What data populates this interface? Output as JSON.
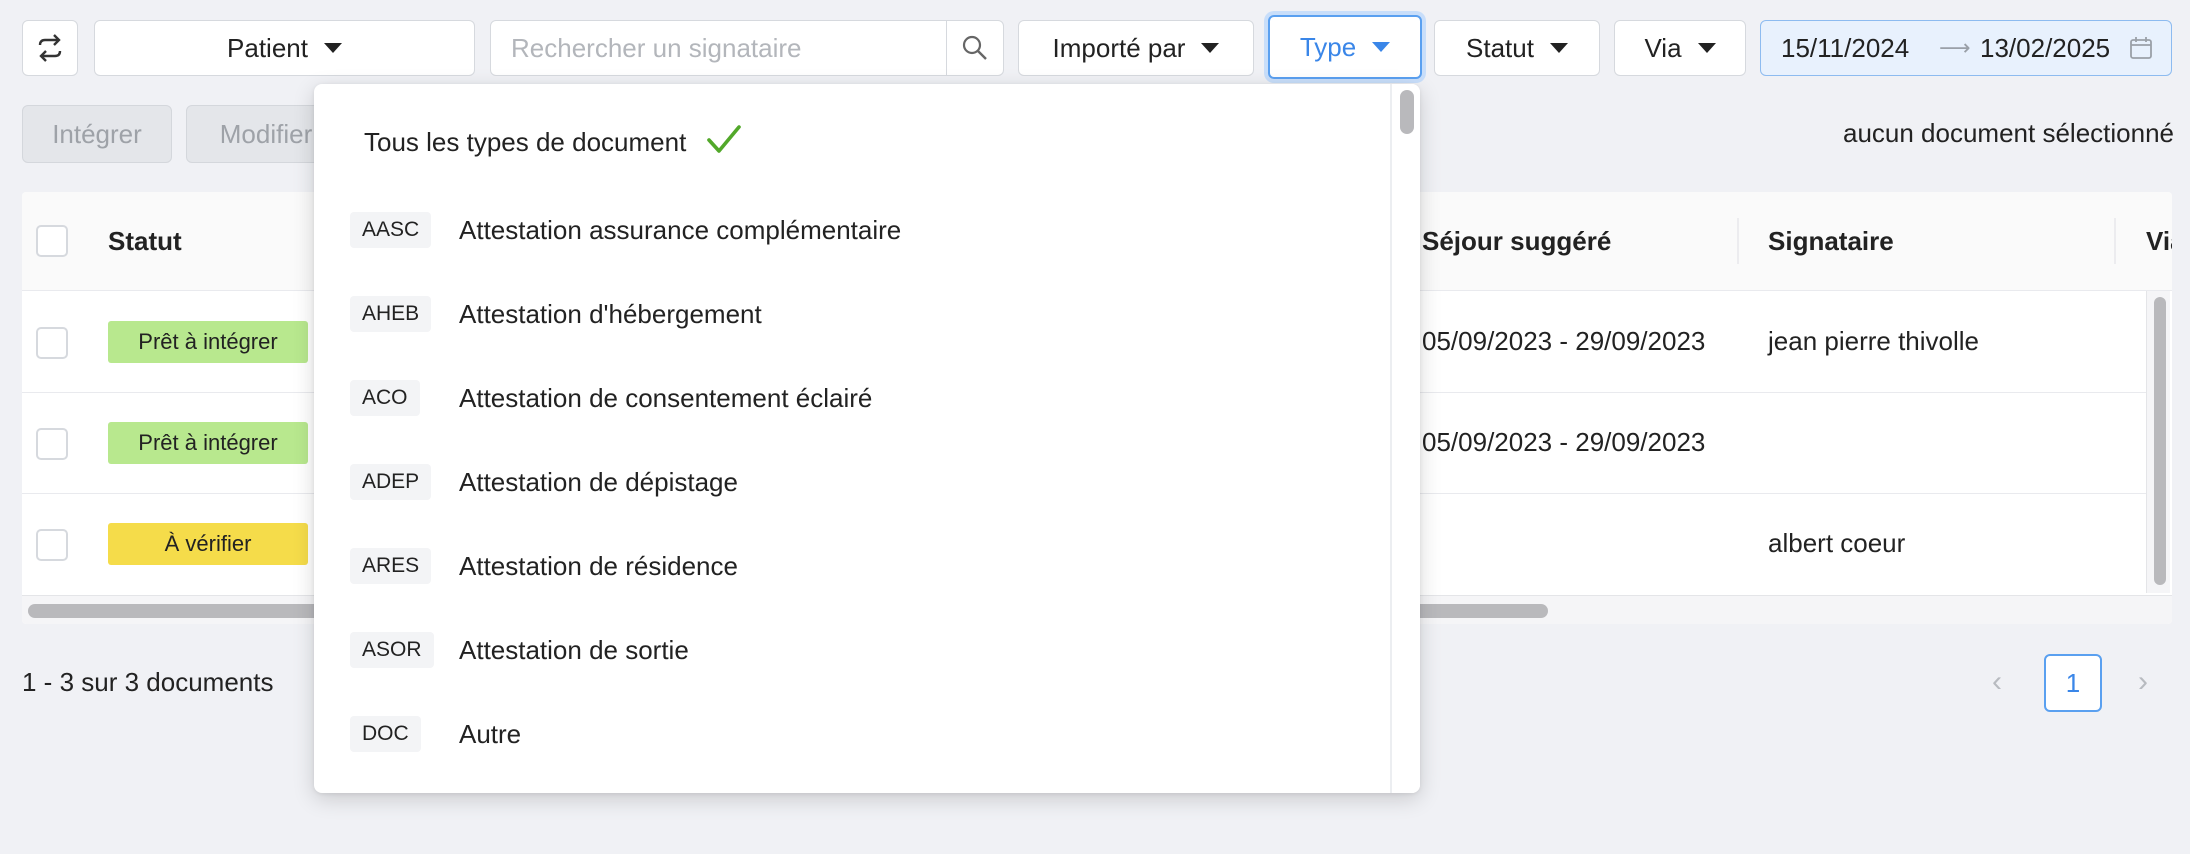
{
  "filters": {
    "patient_label": "Patient",
    "search_placeholder": "Rechercher un signataire",
    "imported_by_label": "Importé par",
    "type_label": "Type",
    "status_label": "Statut",
    "via_label": "Via",
    "date_start": "15/11/2024",
    "date_end": "13/02/2025"
  },
  "actions": {
    "integrate_label": "Intégrer",
    "modify_label": "Modifier",
    "selection_info": "aucun document sélectionné"
  },
  "table": {
    "headers": {
      "status": "Statut",
      "suggested_stay": "Séjour suggéré",
      "signatory": "Signataire",
      "via": "Via"
    },
    "rows": [
      {
        "status": "Prêt à intégrer",
        "status_color": "#b8e88e",
        "stay": "05/09/2023 - 29/09/2023",
        "signatory": "jean pierre thivolle"
      },
      {
        "status": "Prêt à intégrer",
        "status_color": "#b8e88e",
        "stay": "05/09/2023 - 29/09/2023",
        "signatory": ""
      },
      {
        "status": "À vérifier",
        "status_color": "#f5dc4a",
        "stay": "",
        "signatory": "albert coeur"
      }
    ]
  },
  "pagination": {
    "summary": "1 - 3 sur 3 documents",
    "current_page": "1"
  },
  "type_dropdown": {
    "all_label": "Tous les types de document",
    "items": [
      {
        "code": "AASC",
        "label": "Attestation assurance complémentaire"
      },
      {
        "code": "AHEB",
        "label": "Attestation d'hébergement"
      },
      {
        "code": "ACO",
        "label": "Attestation de consentement éclairé"
      },
      {
        "code": "ADEP",
        "label": "Attestation de dépistage"
      },
      {
        "code": "ARES",
        "label": "Attestation de résidence"
      },
      {
        "code": "ASOR",
        "label": "Attestation de sortie"
      },
      {
        "code": "DOC",
        "label": "Autre"
      }
    ]
  },
  "colors": {
    "accent": "#3a86e8",
    "check": "#52a82a",
    "ready_tag": "#b8e88e",
    "verify_tag": "#f5dc4a"
  }
}
